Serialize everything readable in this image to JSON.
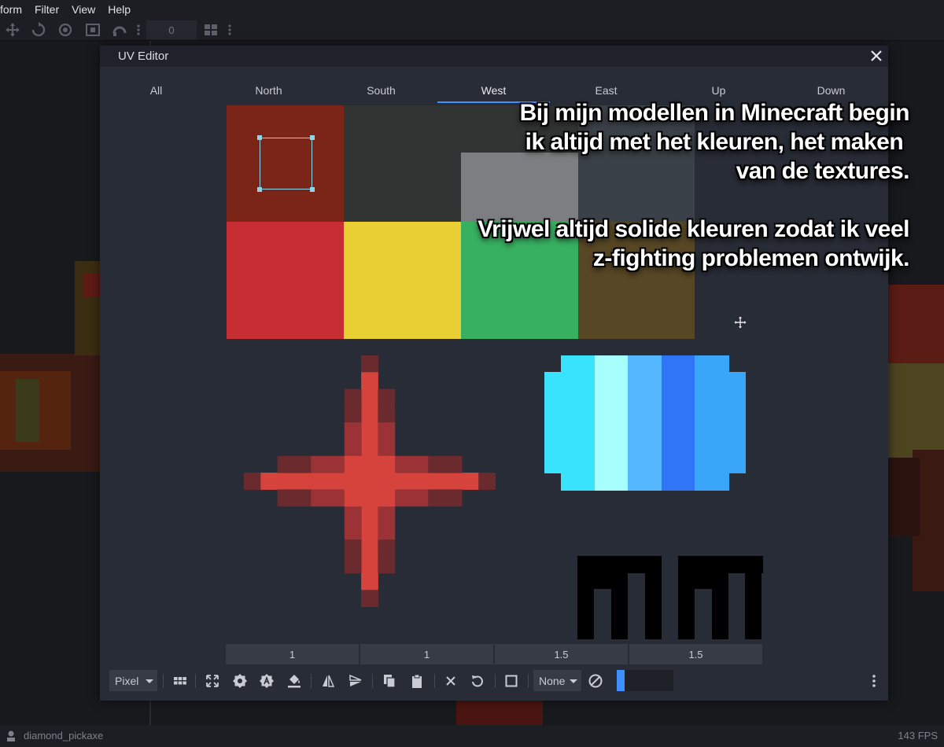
{
  "menu": [
    "form",
    "Filter",
    "View",
    "Help"
  ],
  "toolbar": {
    "number_value": "0"
  },
  "dialog": {
    "title": "UV Editor",
    "tabs": [
      "All",
      "North",
      "South",
      "West",
      "East",
      "Up",
      "Down"
    ],
    "active_tab": "West",
    "swatches": [
      "#7b2418",
      "#323333",
      "#3b4148",
      "#7d7e81",
      "#c72e33",
      "#e8cf33",
      "#37b060",
      "#574725"
    ],
    "overlay_lines": [
      "Bij mijn modellen in Minecraft begin",
      "ik altijd met het kleuren, het maken ",
      "van de textures.",
      "",
      "Vrijwel altijd solide kleuren zodat ik veel",
      "z-fighting problemen ontwijk."
    ],
    "sizes": [
      "1",
      "1",
      "1.5",
      "1.5"
    ],
    "bottom": {
      "snap_mode": "Pixel",
      "cull_mode": "None"
    }
  },
  "status": {
    "model_name": "diamond_pickaxe",
    "fps": "143 FPS"
  },
  "colors": {
    "accent": "#3e90ff",
    "selection": "#8fd7e8",
    "star_red": "#d6433d",
    "diamond_colors": [
      "#39e2fd",
      "#a6fffd",
      "#55b8fe",
      "#2f75f5",
      "#3aa6fa"
    ]
  }
}
